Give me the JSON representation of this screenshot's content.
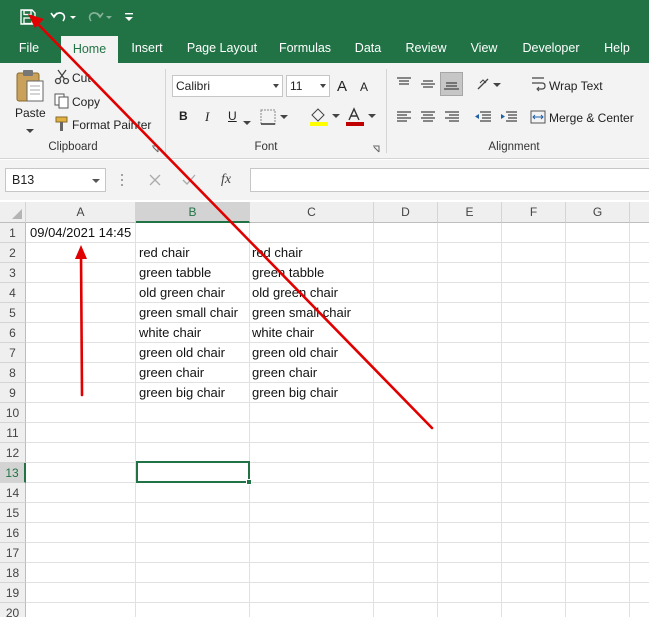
{
  "tabs": [
    "File",
    "Home",
    "Insert",
    "Page Layout",
    "Formulas",
    "Data",
    "Review",
    "View",
    "Developer",
    "Help"
  ],
  "active_tab": "Home",
  "clipboard": {
    "paste_label": "Paste",
    "cut_label": "Cut",
    "copy_label": "Copy",
    "format_painter_label": "Format Painter",
    "group_label": "Clipboard"
  },
  "font": {
    "name": "Calibri",
    "size": "11",
    "bold": "B",
    "italic": "I",
    "underline": "U",
    "group_label": "Font",
    "grow": "A",
    "shrink": "A"
  },
  "alignment": {
    "wrap_text_label": "Wrap Text",
    "merge_center_label": "Merge & Center",
    "group_label": "Alignment"
  },
  "formula_bar": {
    "name_box": "B13",
    "fx": "fx",
    "value": ""
  },
  "columns": [
    "A",
    "B",
    "C",
    "D",
    "E",
    "F",
    "G"
  ],
  "rows": [
    "1",
    "2",
    "3",
    "4",
    "5",
    "6",
    "7",
    "8",
    "9",
    "10",
    "11",
    "12",
    "13",
    "14",
    "15",
    "16",
    "17",
    "18",
    "19",
    "20"
  ],
  "selected_cell": "B13",
  "cells": {
    "A1": "09/04/2021 14:45",
    "B": [
      "red chair",
      "green tabble",
      "old green chair",
      "green small chair",
      "white chair",
      "green old chair",
      "green chair",
      "green big chair"
    ],
    "C": [
      "red chair",
      "green tabble",
      "old green chair",
      "green small chair",
      "white chair",
      "green old chair",
      "green chair",
      "green big chair"
    ]
  },
  "colors": {
    "excel_green": "#217346",
    "annotation_red": "#e00000"
  }
}
